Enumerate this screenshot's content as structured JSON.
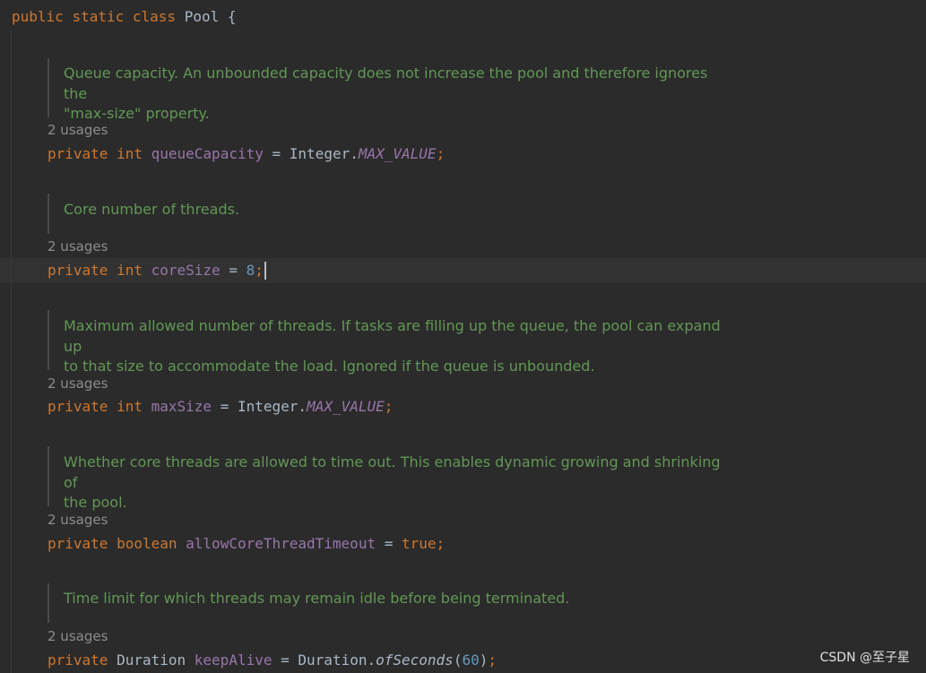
{
  "header": {
    "kw_public": "public",
    "kw_static": "static",
    "kw_class": "class",
    "class_name": "Pool",
    "brace": "{"
  },
  "fields": [
    {
      "doc_line1": "Queue capacity. An unbounded capacity does not increase the pool and therefore ignores the",
      "doc_line2": "\"max-size\" property.",
      "usages": "2 usages",
      "kw_private": "private",
      "type": "int",
      "name": "queueCapacity",
      "eq": "=",
      "value_class": "Integer",
      "dot": ".",
      "value_const": "MAX_VALUE",
      "semi": ";"
    },
    {
      "doc_line1": "Core number of threads.",
      "usages": "2 usages",
      "kw_private": "private",
      "type": "int",
      "name": "coreSize",
      "eq": "=",
      "value_num": "8",
      "semi": ";"
    },
    {
      "doc_line1": "Maximum allowed number of threads. If tasks are filling up the queue, the pool can expand up",
      "doc_line2": "to that size to accommodate the load. Ignored if the queue is unbounded.",
      "usages": "2 usages",
      "kw_private": "private",
      "type": "int",
      "name": "maxSize",
      "eq": "=",
      "value_class": "Integer",
      "dot": ".",
      "value_const": "MAX_VALUE",
      "semi": ";"
    },
    {
      "doc_line1": "Whether core threads are allowed to time out. This enables dynamic growing and shrinking of",
      "doc_line2": "the pool.",
      "usages": "2 usages",
      "kw_private": "private",
      "type": "boolean",
      "name": "allowCoreThreadTimeout",
      "eq": "=",
      "value_kw": "true",
      "semi": ";"
    },
    {
      "doc_line1": "Time limit for which threads may remain idle before being terminated.",
      "usages": "2 usages",
      "kw_private": "private",
      "type": "Duration",
      "name": "keepAlive",
      "eq": "=",
      "value_class": "Duration",
      "dot": ".",
      "value_method": "ofSeconds",
      "paren_open": "(",
      "value_num": "60",
      "paren_close": ")",
      "semi": ";"
    }
  ],
  "watermark": "CSDN @至子星"
}
